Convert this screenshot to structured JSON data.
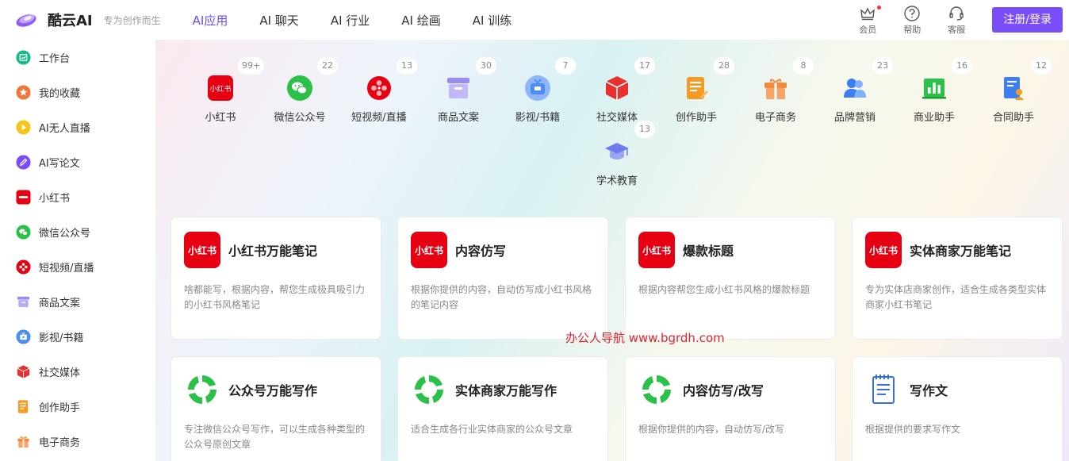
{
  "header": {
    "logo_text": "酷云AI",
    "slogan": "专为创作而生",
    "nav": [
      "AI应用",
      "AI 聊天",
      "AI 行业",
      "AI 绘画",
      "AI 训练"
    ],
    "actions": {
      "member": "会员",
      "help": "帮助",
      "service": "客服"
    },
    "login": "注册/登录"
  },
  "sidebar": {
    "items": [
      {
        "label": "工作台",
        "icon": "dashboard-icon",
        "color": "#19b88a"
      },
      {
        "label": "我的收藏",
        "icon": "star-icon",
        "color": "#f2763a"
      },
      {
        "label": "AI无人直播",
        "icon": "play-icon",
        "color": "#f5c518"
      },
      {
        "label": "AI写论文",
        "icon": "pen-icon",
        "color": "#7a4dfa"
      },
      {
        "label": "小红书",
        "icon": "xiaohongshu-icon",
        "color": "#e60012"
      },
      {
        "label": "微信公众号",
        "icon": "wechat-icon",
        "color": "#2bc149"
      },
      {
        "label": "短视频/直播",
        "icon": "film-icon",
        "color": "#e60012"
      },
      {
        "label": "商品文案",
        "icon": "box-icon",
        "color": "#9b8cf0"
      },
      {
        "label": "影视/书籍",
        "icon": "tv-icon",
        "color": "#4b8cf5"
      },
      {
        "label": "社交媒体",
        "icon": "cube-icon",
        "color": "#e8302f"
      },
      {
        "label": "创作助手",
        "icon": "document-icon",
        "color": "#f59a23"
      },
      {
        "label": "电子商务",
        "icon": "gift-icon",
        "color": "#f28a3c"
      }
    ]
  },
  "categories": [
    {
      "label": "小红书",
      "count": "99+",
      "icon": "xiaohongshu-icon"
    },
    {
      "label": "微信公众号",
      "count": "22",
      "icon": "wechat-icon"
    },
    {
      "label": "短视频/直播",
      "count": "13",
      "icon": "film-icon"
    },
    {
      "label": "商品文案",
      "count": "30",
      "icon": "box-icon"
    },
    {
      "label": "影视/书籍",
      "count": "7",
      "icon": "tv-icon"
    },
    {
      "label": "社交媒体",
      "count": "17",
      "icon": "cube-icon"
    },
    {
      "label": "创作助手",
      "count": "28",
      "icon": "document-icon"
    },
    {
      "label": "电子商务",
      "count": "8",
      "icon": "gift-icon"
    },
    {
      "label": "品牌营销",
      "count": "23",
      "icon": "people-icon"
    },
    {
      "label": "商业助手",
      "count": "16",
      "icon": "bar-chart-icon"
    },
    {
      "label": "合同助手",
      "count": "12",
      "icon": "contract-icon"
    },
    {
      "label": "学术教育",
      "count": "13",
      "icon": "graduation-cap-icon"
    }
  ],
  "cards": [
    {
      "title": "小红书万能笔记",
      "desc": "啥都能写，根据内容，帮您生成极具吸引力的小红书风格笔记",
      "logo": "xiaohongshu-logo",
      "logo_text": "小红书"
    },
    {
      "title": "内容仿写",
      "desc": "根据你提供的内容，自动仿写成小红书风格的笔记内容",
      "logo": "xiaohongshu-logo",
      "logo_text": "小红书"
    },
    {
      "title": "爆款标题",
      "desc": "根据内容帮您生成小红书风格的爆款标题",
      "logo": "xiaohongshu-logo",
      "logo_text": "小红书"
    },
    {
      "title": "实体商家万能笔记",
      "desc": "专为实体店商家创作，适合生成各类型实体商家小红书笔记",
      "logo": "xiaohongshu-logo",
      "logo_text": "小红书"
    },
    {
      "title": "公众号万能写作",
      "desc": "专注微信公众号写作，可以生成各种类型的公众号原创文章",
      "logo": "wechat-logo"
    },
    {
      "title": "实体商家万能写作",
      "desc": "适合生成各行业实体商家的公众号文章",
      "logo": "wechat-logo"
    },
    {
      "title": "内容仿写/改写",
      "desc": "根据你提供的内容，自动仿写/改写",
      "logo": "wechat-logo"
    },
    {
      "title": "写作文",
      "desc": "根据提供的要求写作文",
      "logo": "notepad-logo"
    }
  ],
  "watermark": "办公人导航  www.bgrdh.com",
  "colors": {
    "accent": "#7a4dfa",
    "brand_red": "#e60012",
    "wechat_green": "#2bc149"
  }
}
